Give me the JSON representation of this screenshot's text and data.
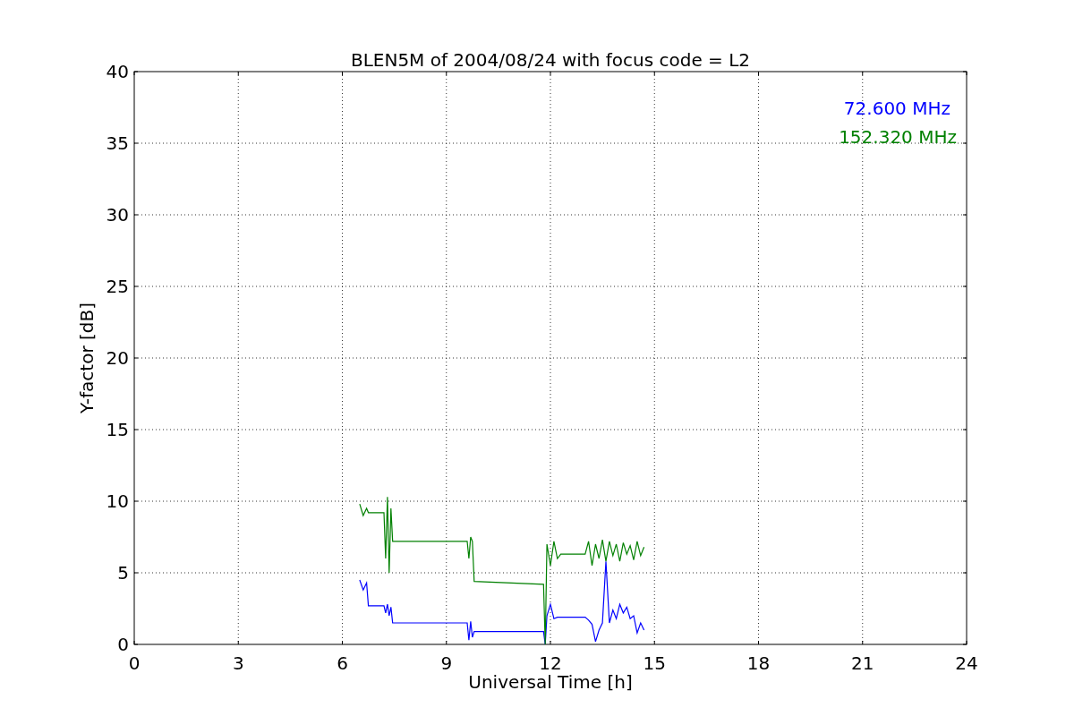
{
  "figure": {
    "chart_data": {
      "type": "line",
      "title": "BLEN5M of 2004/08/24 with focus code = L2",
      "xlabel": "Universal Time [h]",
      "ylabel": "Y-factor [dB]",
      "x": [
        6.5,
        6.6,
        6.7,
        6.75,
        7.2,
        7.25,
        7.3,
        7.35,
        7.4,
        7.45,
        9.6,
        9.65,
        9.7,
        9.75,
        9.8,
        11.8,
        11.85,
        11.9,
        12.0,
        12.1,
        12.2,
        12.3,
        13.0,
        13.1,
        13.2,
        13.3,
        13.4,
        13.5,
        13.6,
        13.7,
        13.8,
        13.9,
        14.0,
        14.1,
        14.2,
        14.3,
        14.4,
        14.5,
        14.6,
        14.7
      ],
      "series": [
        {
          "name": "72.600 MHz",
          "color": "#0000ff",
          "values": [
            4.5,
            3.8,
            4.3,
            2.7,
            2.7,
            2.2,
            2.8,
            2.0,
            2.6,
            1.5,
            1.5,
            0.3,
            1.6,
            0.5,
            0.9,
            0.9,
            0.0,
            2.0,
            2.8,
            1.8,
            1.9,
            1.9,
            1.9,
            1.7,
            1.4,
            0.2,
            1.0,
            1.5,
            5.8,
            1.5,
            2.4,
            1.8,
            2.8,
            2.2,
            2.6,
            1.8,
            2.0,
            0.8,
            1.5,
            1.0
          ]
        },
        {
          "name": "152.320 MHz",
          "color": "#008000",
          "values": [
            9.8,
            9.0,
            9.5,
            9.2,
            9.2,
            6.0,
            10.3,
            5.0,
            9.5,
            7.2,
            7.2,
            6.0,
            7.5,
            7.2,
            4.4,
            4.2,
            0.0,
            7.0,
            5.5,
            7.2,
            6.0,
            6.3,
            6.3,
            7.2,
            5.5,
            7.0,
            6.0,
            7.3,
            5.8,
            7.2,
            6.2,
            7.0,
            5.8,
            7.1,
            6.3,
            6.9,
            5.9,
            7.2,
            6.2,
            6.8
          ]
        }
      ],
      "xlim": [
        0,
        24
      ],
      "ylim": [
        0,
        40
      ],
      "xticks": [
        0,
        3,
        6,
        9,
        12,
        15,
        18,
        21,
        24
      ],
      "yticks": [
        0,
        5,
        10,
        15,
        20,
        25,
        30,
        35,
        40
      ],
      "grid": true
    }
  }
}
